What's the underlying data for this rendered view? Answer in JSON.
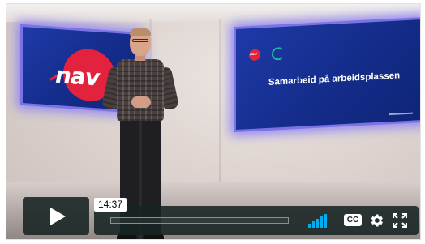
{
  "slide": {
    "title": "Samarbeid på arbeidsplassen",
    "logo_text": "nav"
  },
  "player": {
    "current_time": "14:37",
    "progress_fraction": 0.0,
    "volume_level": 1.0,
    "play_icon": "play-icon",
    "cc_label": "CC",
    "settings_icon": "gear-icon",
    "fullscreen_icon": "fullscreen-icon",
    "accent_color": "#00adef"
  }
}
